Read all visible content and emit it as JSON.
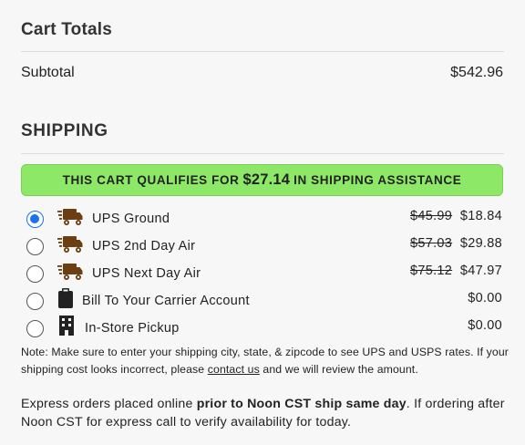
{
  "cart_totals": {
    "title": "Cart Totals",
    "subtotal_label": "Subtotal",
    "subtotal_value": "$542.96"
  },
  "shipping": {
    "title": "SHIPPING",
    "banner": {
      "prefix": "THIS CART QUALIFIES FOR",
      "amount": "$27.14",
      "suffix": "IN SHIPPING ASSISTANCE",
      "color": "#8de867"
    },
    "options": [
      {
        "label": "UPS Ground",
        "icon": "truck-icon",
        "selected": true,
        "old_price": "$45.99",
        "price": "$18.84"
      },
      {
        "label": "UPS 2nd Day Air",
        "icon": "truck-icon",
        "selected": false,
        "old_price": "$57.03",
        "price": "$29.88"
      },
      {
        "label": "UPS Next Day Air",
        "icon": "truck-icon",
        "selected": false,
        "old_price": "$75.12",
        "price": "$47.97"
      },
      {
        "label": "Bill To Your Carrier Account",
        "icon": "clipboard-icon",
        "selected": false,
        "old_price": "",
        "price": "$0.00"
      },
      {
        "label": "In-Store Pickup",
        "icon": "building-icon",
        "selected": false,
        "old_price": "",
        "price": "$0.00"
      }
    ],
    "accent_color": "#1a73e8"
  },
  "note": {
    "text_1": "Note: Make sure to enter your shipping city, state, & zipcode to see UPS and USPS rates. If your shipping cost looks incorrect, please",
    "link": "contact us",
    "text_2": "and we will review the amount."
  },
  "express": {
    "text_1": "Express orders placed online",
    "bold": "prior to Noon CST ship same day",
    "text_2": ". If ordering after Noon CST for express call to verify availability for today."
  }
}
